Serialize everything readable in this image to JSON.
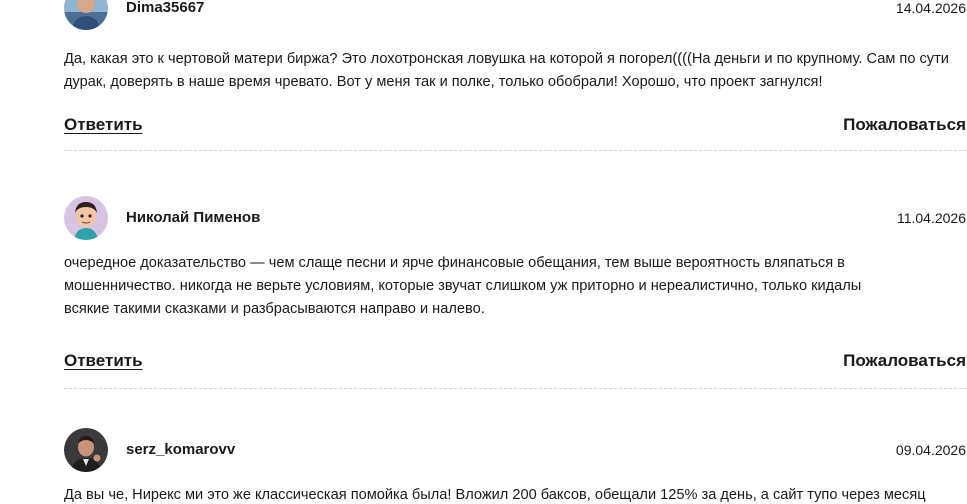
{
  "comments": [
    {
      "author": "Dima35667",
      "date": "14.04.2026",
      "text": "Да, какая это к чертовой матери биржа? Это лохотронская ловушка на которой я погорел((((На деньги и по крупному. Сам по сути дурак, доверять в наше время чревато. Вот у меня так и полке, только обобрали! Хорошо, что проект загнулся!",
      "avatar_icon": "user-photo-avatar",
      "reply_label": "Ответить",
      "report_label": "Пожаловаться"
    },
    {
      "author": "Николай Пименов",
      "date": "11.04.2026",
      "text": "очередное доказательство — чем слаще песни и ярче финансовые обещания, тем выше вероятность вляпаться в мошенничество. никогда не верьте условиям, которые звучат слишком уж приторно и нереалистично, только кидалы всякие такими сказками и разбрасываются направо и налево.",
      "avatar_icon": "cartoon-avatar",
      "reply_label": "Ответить",
      "report_label": "Пожаловаться"
    },
    {
      "author": "serz_komarovv",
      "date": "09.04.2026",
      "text": "Да вы че, Нирекс ми это же классическая помойка была! Вложил 200 баксов, обещали 125% за день, а сайт тупо через месяц",
      "avatar_icon": "user-photo-avatar"
    }
  ],
  "colors": {
    "text": "#1a1a1a",
    "divider": "#d4d4d4"
  }
}
